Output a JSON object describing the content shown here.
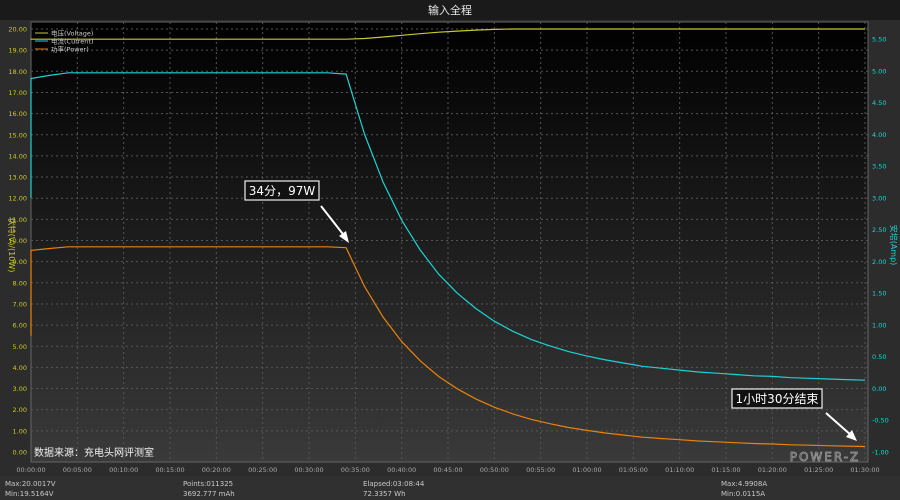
{
  "chart_data": {
    "type": "line",
    "title": "输入全程",
    "xlabel": "",
    "ylabel_left": "伏特(V)/(10W)",
    "ylabel_right": "安培(Amp)",
    "xlim_minutes": [
      0,
      90
    ],
    "ylim_left": [
      0,
      20
    ],
    "ylim_right": [
      -1,
      5.66
    ],
    "grid": true,
    "legend_position": "top-left",
    "x_ticks": [
      "00:00:00",
      "00:05:00",
      "00:10:00",
      "00:15:00",
      "00:20:00",
      "00:25:00",
      "00:30:00",
      "00:35:00",
      "00:40:00",
      "00:45:00",
      "00:50:00",
      "00:55:00",
      "01:00:00",
      "01:05:00",
      "01:10:00",
      "01:15:00",
      "01:20:00",
      "01:25:00",
      "01:30:00"
    ],
    "y_ticks_left": [
      "0.00",
      "1.00",
      "2.00",
      "3.00",
      "4.00",
      "5.00",
      "6.00",
      "7.00",
      "8.00",
      "9.00",
      "10.00",
      "11.00",
      "12.00",
      "13.00",
      "14.00",
      "15.00",
      "16.00",
      "17.00",
      "18.00",
      "19.00",
      "20.00"
    ],
    "y_ticks_right": [
      "-1.00",
      "-0.50",
      "0.00",
      "0.50",
      "1.00",
      "1.50",
      "2.00",
      "2.50",
      "3.00",
      "3.50",
      "4.00",
      "4.50",
      "5.00",
      "5.50"
    ],
    "x_minutes": [
      0,
      2,
      4,
      6,
      8,
      10,
      12,
      14,
      16,
      18,
      20,
      22,
      24,
      26,
      28,
      30,
      32,
      34,
      36,
      38,
      40,
      42,
      44,
      46,
      48,
      50,
      52,
      54,
      56,
      58,
      60,
      62,
      64,
      66,
      68,
      70,
      72,
      74,
      76,
      78,
      80,
      82,
      84,
      86,
      88,
      90
    ],
    "series": [
      {
        "name": "电压(Voltage)",
        "axis": "left",
        "color": "#c8c832",
        "values": [
          19.52,
          19.52,
          19.52,
          19.52,
          19.52,
          19.52,
          19.52,
          19.52,
          19.52,
          19.52,
          19.52,
          19.52,
          19.52,
          19.52,
          19.52,
          19.52,
          19.52,
          19.52,
          19.55,
          19.62,
          19.7,
          19.78,
          19.85,
          19.9,
          19.95,
          19.98,
          20.0,
          20.0,
          20.0,
          20.0,
          20.0,
          20.0,
          20.0,
          20.0,
          20.0,
          20.0,
          20.0,
          20.0,
          20.0,
          20.0,
          20.0,
          20.0,
          20.0,
          20.0,
          20.0,
          20.0
        ]
      },
      {
        "name": "电流(Current)",
        "axis": "right",
        "color": "#1ed2d2",
        "values": [
          4.88,
          4.93,
          4.97,
          4.97,
          4.97,
          4.97,
          4.97,
          4.97,
          4.97,
          4.97,
          4.97,
          4.97,
          4.97,
          4.97,
          4.97,
          4.97,
          4.97,
          4.95,
          4.0,
          3.25,
          2.65,
          2.18,
          1.8,
          1.5,
          1.26,
          1.06,
          0.9,
          0.77,
          0.67,
          0.58,
          0.51,
          0.45,
          0.4,
          0.35,
          0.32,
          0.29,
          0.26,
          0.24,
          0.22,
          0.2,
          0.19,
          0.17,
          0.16,
          0.15,
          0.14,
          0.13
        ]
      },
      {
        "name": "功率(Power)",
        "axis": "left",
        "color": "#e8820a",
        "values": [
          9.53,
          9.62,
          9.7,
          9.7,
          9.7,
          9.7,
          9.7,
          9.7,
          9.7,
          9.7,
          9.7,
          9.7,
          9.7,
          9.7,
          9.7,
          9.7,
          9.7,
          9.66,
          7.82,
          6.38,
          5.22,
          4.31,
          3.57,
          2.99,
          2.51,
          2.12,
          1.8,
          1.54,
          1.34,
          1.16,
          1.02,
          0.9,
          0.8,
          0.7,
          0.64,
          0.58,
          0.52,
          0.48,
          0.44,
          0.4,
          0.38,
          0.34,
          0.32,
          0.3,
          0.28,
          0.26
        ]
      }
    ],
    "annotations": [
      {
        "text": "34分，97W",
        "x_minutes": 34,
        "y_left": 9.7
      },
      {
        "text": "1小时30分结束",
        "x_minutes": 90,
        "y_left": 0.3
      }
    ],
    "source_note": "数据来源：充电头网评测室",
    "watermark": "POWER-Z"
  },
  "stats": {
    "voltage_max": "Max:20.0017V",
    "voltage_min": "Min:19.5164V",
    "points": "Points:011325",
    "capacity": "3692.777 mAh",
    "elapsed": "Elapsed:03:08:44",
    "energy": "72.3357 Wh",
    "current_max": "Max:4.9908A",
    "current_min": "Min:0.0115A"
  }
}
